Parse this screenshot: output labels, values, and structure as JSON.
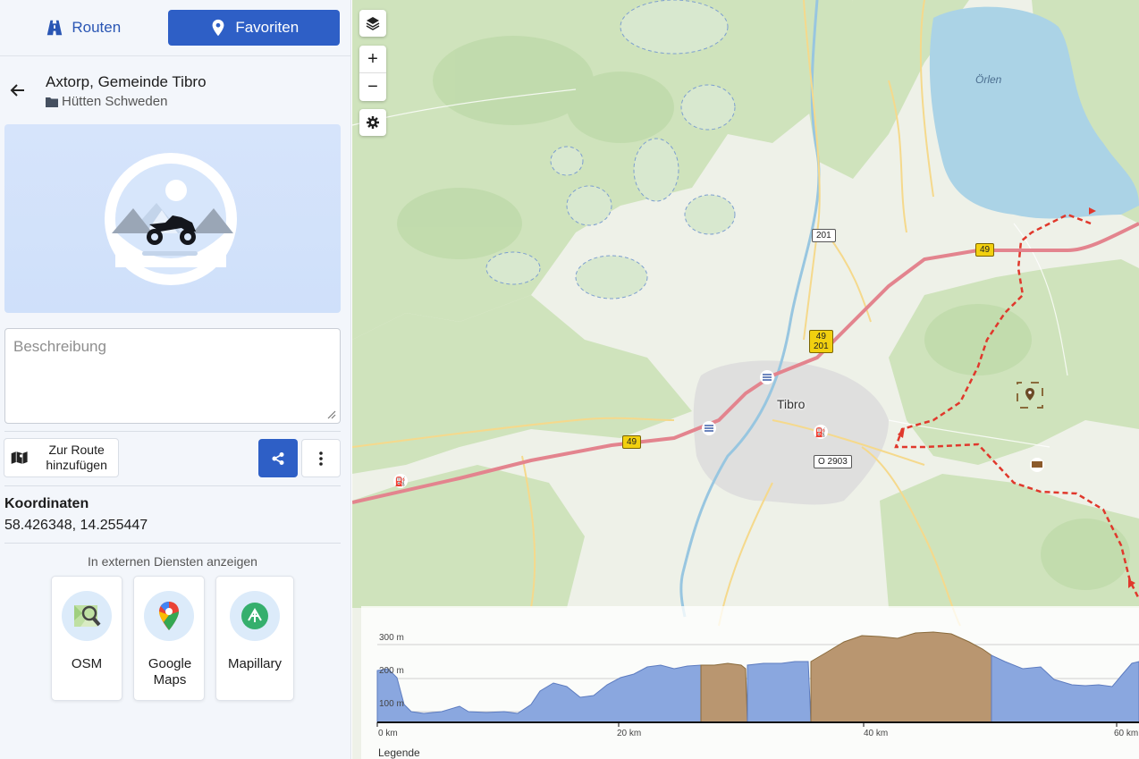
{
  "tabs": {
    "routes": "Routen",
    "favorites": "Favoriten"
  },
  "place": {
    "title": "Axtorp, Gemeinde Tibro",
    "category": "Hütten Schweden"
  },
  "description": {
    "placeholder": "Beschreibung"
  },
  "actions": {
    "add_to_route": "Zur Route hinzufügen"
  },
  "coordinates": {
    "label": "Koordinaten",
    "value": "58.426348, 14.255447"
  },
  "external": {
    "title": "In externen Diensten anzeigen",
    "services": [
      "OSM",
      "Google Maps",
      "Mapillary"
    ]
  },
  "map": {
    "lake_label": "Örlen",
    "town_label": "Tibro",
    "road_labels": {
      "r49": "49",
      "r201": "201",
      "r49_201": "49\n201",
      "o2903": "O 2903"
    },
    "elevation": {
      "y_labels": [
        "300 m",
        "200 m",
        "100 m"
      ],
      "x_labels": [
        "0 km",
        "20 km",
        "40 km",
        "60 km"
      ],
      "legend": "Legende"
    }
  },
  "colors": {
    "accent": "#2e5fc6",
    "route": "#e0382c",
    "road": "#e3848e",
    "elev_blue": "#8aa7df",
    "elev_brown": "#b99670"
  }
}
